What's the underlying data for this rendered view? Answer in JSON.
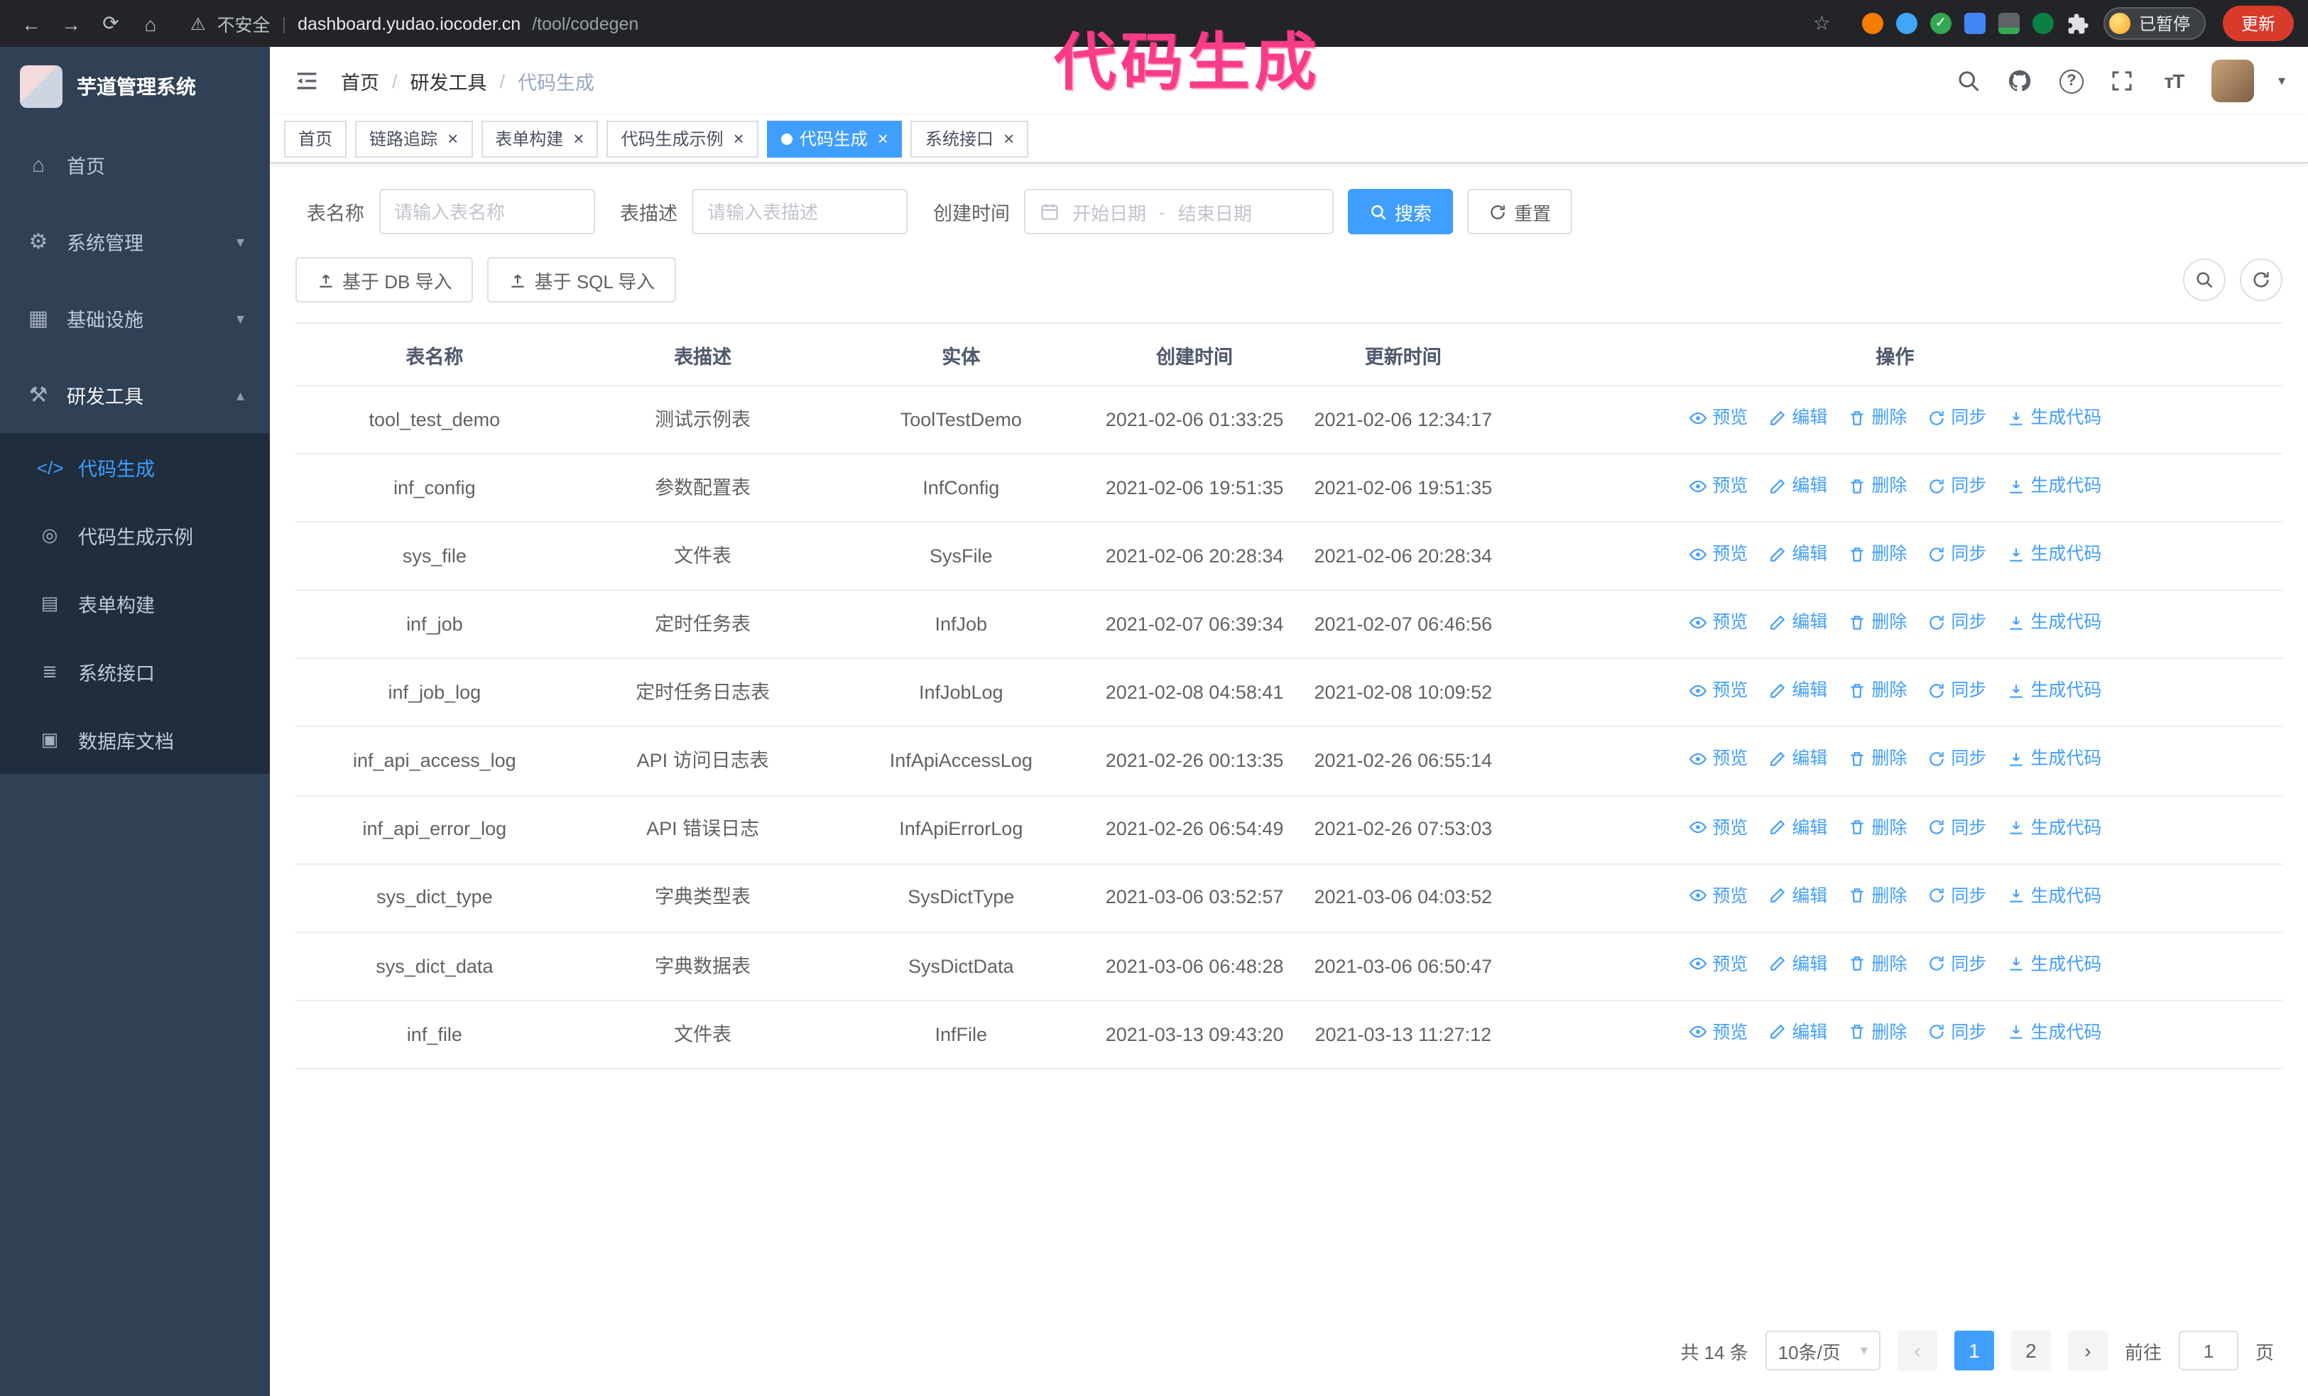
{
  "annotation": {
    "text": "代码生成"
  },
  "browser": {
    "security_label": "不安全",
    "url_host": "dashboard.yudao.iocoder.cn",
    "url_path": "/tool/codegen",
    "paused_badge": "已暂停",
    "update_button": "更新"
  },
  "app": {
    "title": "芋道管理系统"
  },
  "icons": {
    "back": "←",
    "forward": "→",
    "reload": "⟳",
    "home": "⌂",
    "warning": "⚠",
    "divider": "|",
    "star": "☆",
    "menu_home": "⌂",
    "menu_system": "⚙",
    "menu_infra": "▦",
    "menu_devtool": "⚒",
    "sub_codegen": "</>",
    "sub_demo": "◎",
    "sub_form": "▤",
    "sub_api": "≣",
    "sub_db": "▣",
    "chevron_down": "▾",
    "chevron_up": "▴",
    "caret_down": "▾",
    "close": "×",
    "prev": "‹",
    "next": "›",
    "range_separator_icon": ""
  },
  "sidebar": {
    "items": [
      {
        "label": "首页"
      },
      {
        "label": "系统管理"
      },
      {
        "label": "基础设施"
      },
      {
        "label": "研发工具"
      }
    ],
    "subitems": [
      {
        "label": "代码生成"
      },
      {
        "label": "代码生成示例"
      },
      {
        "label": "表单构建"
      },
      {
        "label": "系统接口"
      },
      {
        "label": "数据库文档"
      }
    ]
  },
  "header": {
    "breadcrumb": {
      "items": [
        "首页",
        "研发工具",
        "代码生成"
      ],
      "separator": "/"
    }
  },
  "tabs": [
    {
      "label": "首页"
    },
    {
      "label": "链路追踪"
    },
    {
      "label": "表单构建"
    },
    {
      "label": "代码生成示例"
    },
    {
      "label": "代码生成"
    },
    {
      "label": "系统接口"
    }
  ],
  "filters": {
    "table_name_label": "表名称",
    "table_name_placeholder": "请输入表名称",
    "table_desc_label": "表描述",
    "table_desc_placeholder": "请输入表描述",
    "create_time_label": "创建时间",
    "start_placeholder": "开始日期",
    "range_separator": "-",
    "end_placeholder": "结束日期",
    "search_button": "搜索",
    "reset_button": "重置"
  },
  "toolbar": {
    "import_db_button": "基于 DB 导入",
    "import_sql_button": "基于 SQL 导入"
  },
  "table": {
    "columns": [
      "表名称",
      "表描述",
      "实体",
      "创建时间",
      "更新时间",
      "操作"
    ],
    "actions": [
      {
        "key": "preview",
        "label": "预览"
      },
      {
        "key": "edit",
        "label": "编辑"
      },
      {
        "key": "delete",
        "label": "删除"
      },
      {
        "key": "sync",
        "label": "同步"
      },
      {
        "key": "generate",
        "label": "生成代码"
      }
    ],
    "rows": [
      {
        "name": "tool_test_demo",
        "desc": "测试示例表",
        "entity": "ToolTestDemo",
        "created": "2021-02-06 01:33:25",
        "updated": "2021-02-06 12:34:17"
      },
      {
        "name": "inf_config",
        "desc": "参数配置表",
        "entity": "InfConfig",
        "created": "2021-02-06 19:51:35",
        "updated": "2021-02-06 19:51:35"
      },
      {
        "name": "sys_file",
        "desc": "文件表",
        "entity": "SysFile",
        "created": "2021-02-06 20:28:34",
        "updated": "2021-02-06 20:28:34"
      },
      {
        "name": "inf_job",
        "desc": "定时任务表",
        "entity": "InfJob",
        "created": "2021-02-07 06:39:34",
        "updated": "2021-02-07 06:46:56"
      },
      {
        "name": "inf_job_log",
        "desc": "定时任务日志表",
        "entity": "InfJobLog",
        "created": "2021-02-08 04:58:41",
        "updated": "2021-02-08 10:09:52"
      },
      {
        "name": "inf_api_access_log",
        "desc": "API 访问日志表",
        "entity": "InfApiAccessLog",
        "created": "2021-02-26 00:13:35",
        "updated": "2021-02-26 06:55:14"
      },
      {
        "name": "inf_api_error_log",
        "desc": "API 错误日志",
        "entity": "InfApiErrorLog",
        "created": "2021-02-26 06:54:49",
        "updated": "2021-02-26 07:53:03"
      },
      {
        "name": "sys_dict_type",
        "desc": "字典类型表",
        "entity": "SysDictType",
        "created": "2021-03-06 03:52:57",
        "updated": "2021-03-06 04:03:52"
      },
      {
        "name": "sys_dict_data",
        "desc": "字典数据表",
        "entity": "SysDictData",
        "created": "2021-03-06 06:48:28",
        "updated": "2021-03-06 06:50:47"
      },
      {
        "name": "inf_file",
        "desc": "文件表",
        "entity": "InfFile",
        "created": "2021-03-13 09:43:20",
        "updated": "2021-03-13 11:27:12"
      }
    ]
  },
  "pagination": {
    "total_text": "共 14 条",
    "page_size": "10条/页",
    "pages": [
      "1",
      "2"
    ],
    "goto_label": "前往",
    "goto_value": "1",
    "goto_unit": "页"
  },
  "colors": {
    "primary": "#409eff",
    "sidebar_bg": "#304156",
    "submenu_bg": "#1f2d3d",
    "annotation": "#fa3c88",
    "update_button": "#d93b2b"
  }
}
